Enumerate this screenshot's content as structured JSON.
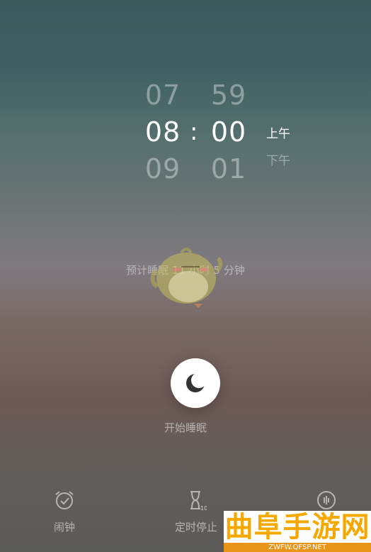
{
  "time_picker": {
    "hour_prev": "07",
    "hour_selected": "08",
    "hour_next": "09",
    "separator": ":",
    "minute_prev": "59",
    "minute_selected": "00",
    "minute_next": "01",
    "period_selected": "上午",
    "period_next": "下午"
  },
  "estimate_text": "预计睡眠 11 小时 5 分钟",
  "start_button": {
    "label": "开始睡眠",
    "icon": "moon-icon"
  },
  "bottom_tabs": [
    {
      "label": "闹钟",
      "icon": "alarm-clock-icon"
    },
    {
      "label": "定时停止",
      "icon": "hourglass-timer-icon",
      "badge": "10"
    },
    {
      "label": "",
      "icon": "sound-wave-icon"
    }
  ],
  "watermark": {
    "title": "曲阜手游网",
    "url": "ZWFW.QFSP.NET"
  },
  "colors": {
    "accent_white": "#ffffff",
    "watermark_orange": "#f5a800",
    "watermark_bar": "#e8951a"
  }
}
